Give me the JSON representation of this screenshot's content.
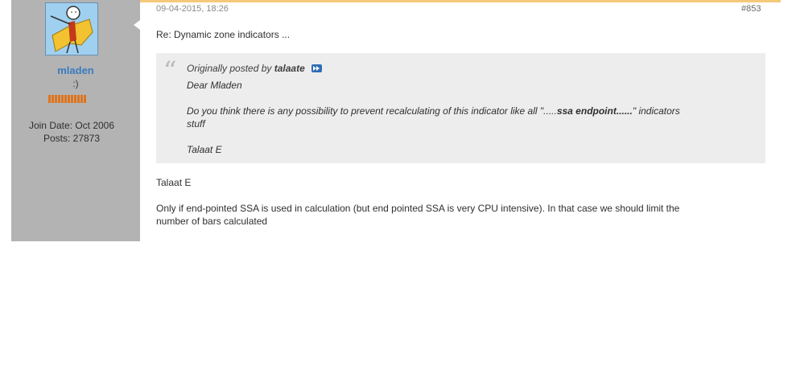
{
  "colors": {
    "accent_bar": "#f6c97a",
    "sidebar_bg": "#b3b3b3",
    "username": "#3a7bbf",
    "reputation": "#e0731b",
    "quote_bg": "#ededed"
  },
  "post": {
    "date": "09-04-2015, 18:26",
    "number": "#853",
    "title": "Re: Dynamic zone indicators ...",
    "author": {
      "name": "mladen",
      "title": ":)",
      "avatar_icon": "scarecrow-avatar-icon",
      "reputation_pips": 12,
      "join_date": "Join Date: Oct 2006",
      "posts": "Posts: 27873"
    },
    "quote": {
      "icon": "quote-mark-icon",
      "prefix": "Originally posted by",
      "author": "talaate",
      "goto_icon": "view-post-icon",
      "greeting": "Dear Mladen",
      "text_before": "Do you think there is any possibility to prevent recalculating of this indicator like all \".....",
      "text_bold": "ssa endpoint......",
      "text_after": "\" indicators",
      "text_line2": "stuff",
      "signature": "Talaat E"
    },
    "reply_to": "Talaat E",
    "body_line1": "Only if end-pointed SSA is used in calculation (but end pointed SSA is very CPU intensive). In that case we should limit the",
    "body_line2": "number of bars calculated"
  }
}
